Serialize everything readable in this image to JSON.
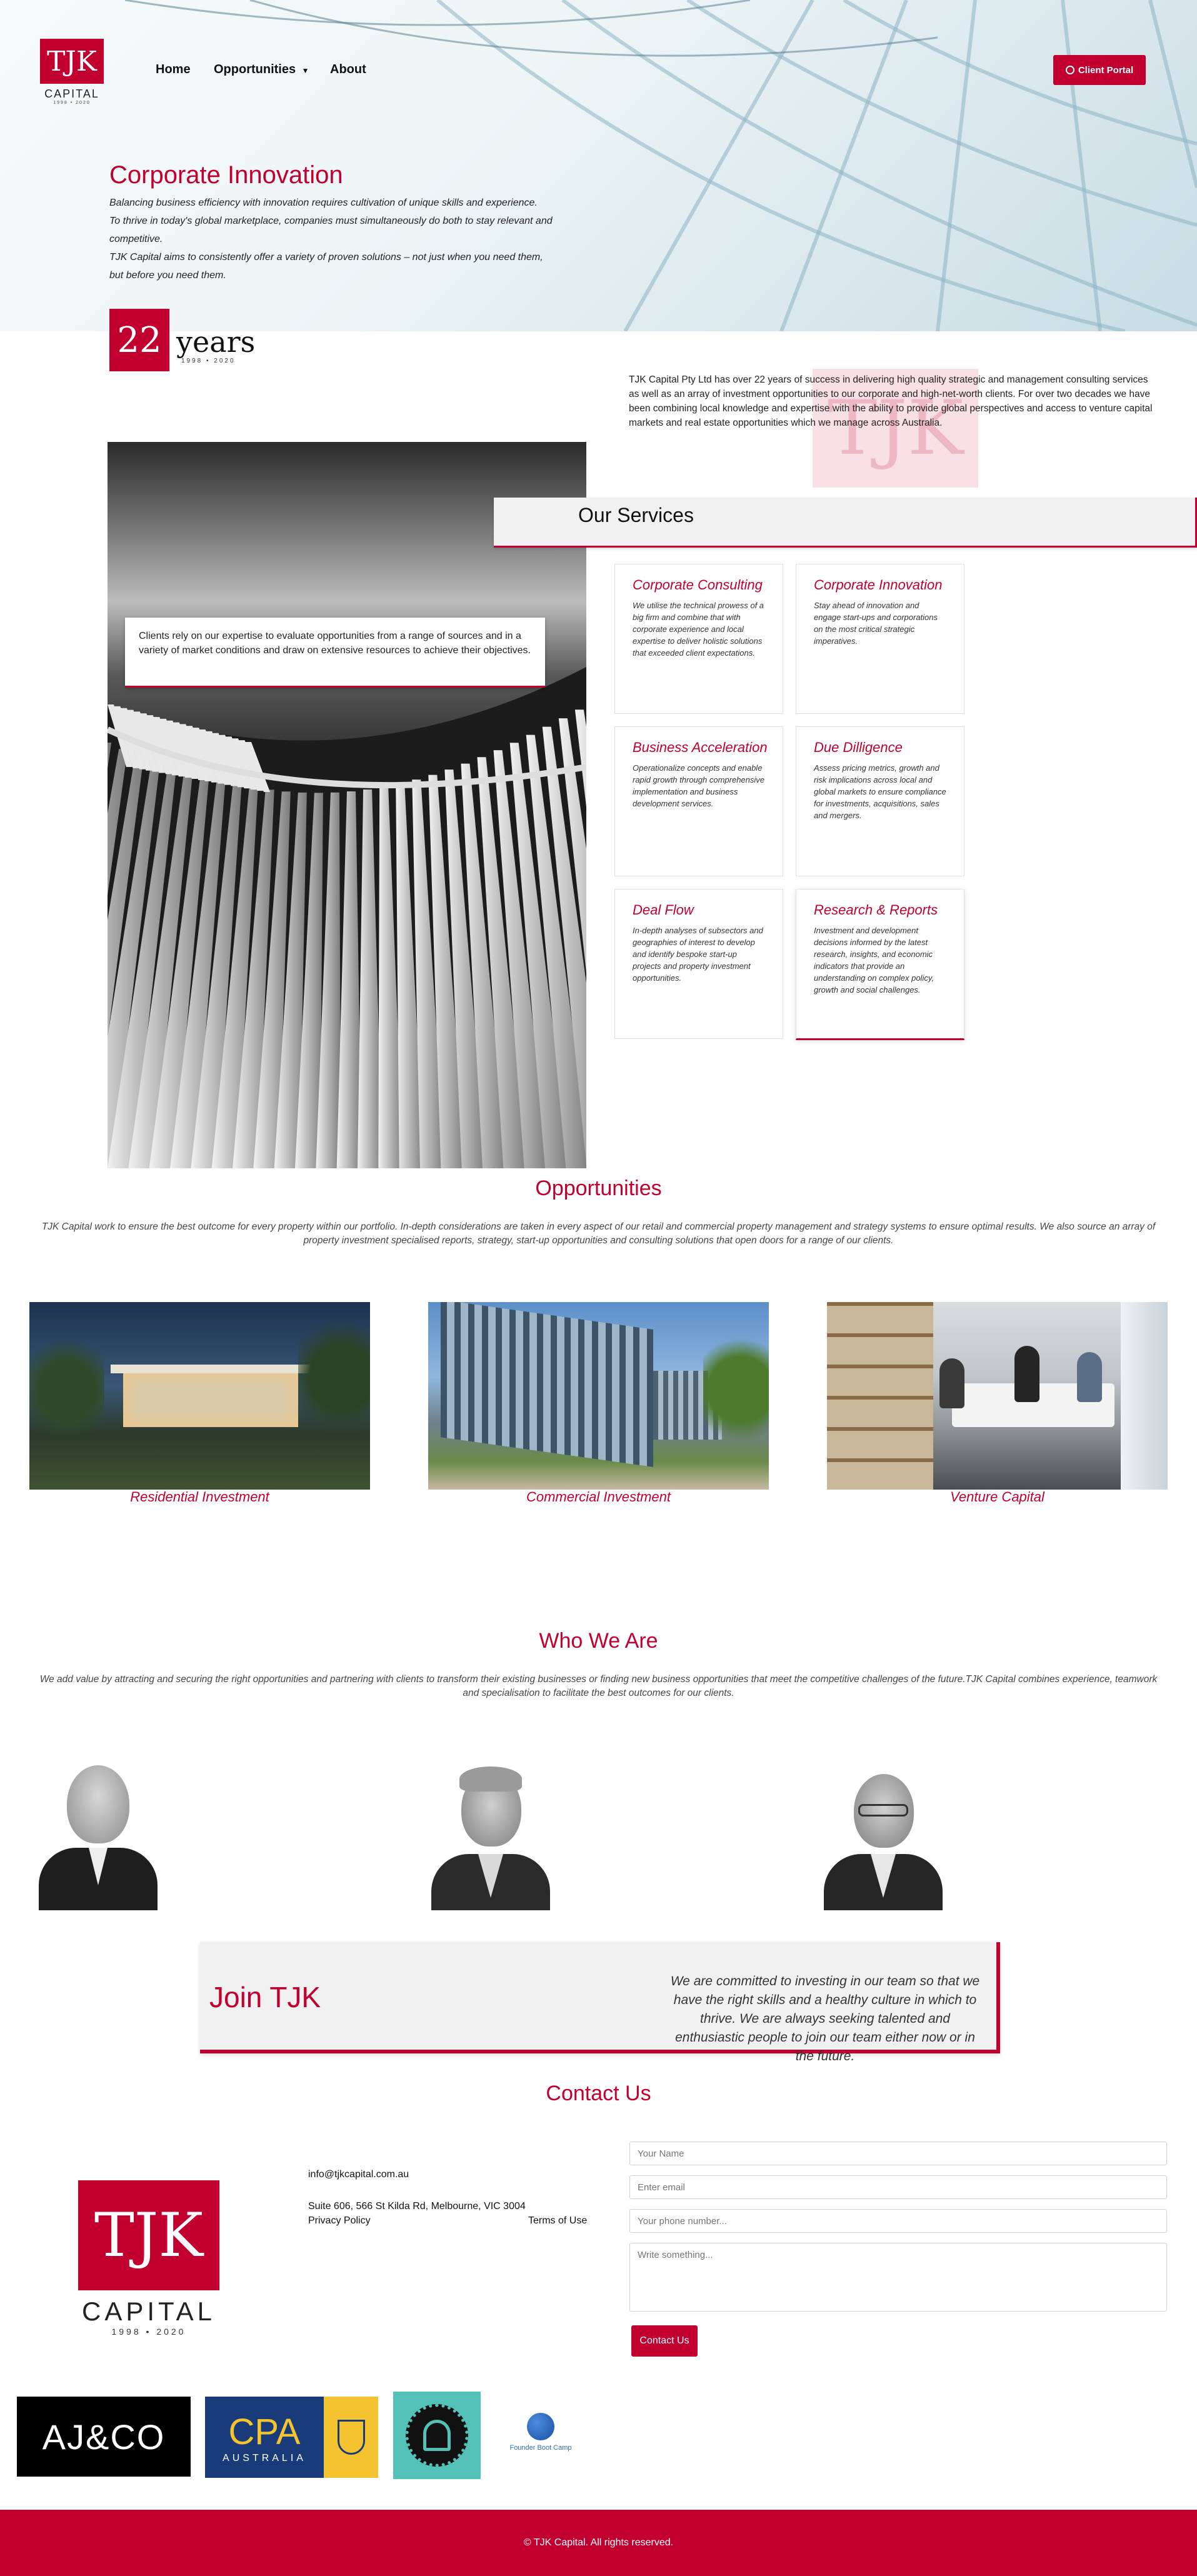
{
  "brand": {
    "logo_letters": "TJK",
    "logo_word": "CAPITAL",
    "logo_years": "1998 • 2020",
    "accent": "#c2002f"
  },
  "nav": {
    "home": "Home",
    "opportunities": "Opportunities",
    "about": "About",
    "client_portal": "Client Portal"
  },
  "hero": {
    "title": "Corporate Innovation",
    "lines": [
      "Balancing business efficiency with innovation requires cultivation of unique skills and experience.",
      "To thrive in today's global marketplace, companies must simultaneously do both to stay relevant and",
      "competitive.",
      "TJK Capital aims to consistently offer a variety of proven solutions – not just when you need them,",
      "but before you need them."
    ]
  },
  "years_badge": {
    "number": "22",
    "word": "years",
    "range": "1998 • 2020"
  },
  "about": "TJK Capital Pty Ltd has over 22 years of success in delivering high quality strategic and management consulting services as well as an array of investment opportunities to our corporate and high-net-worth clients. For over two decades we have been combining local knowledge and expertise with the ability to provide global perspectives and access to venture capital markets and real estate opportunities which we manage across Australia.",
  "callout": "Clients rely on our expertise to evaluate opportunities from a range of sources and in a variety of market conditions and draw on extensive resources to achieve their objectives.",
  "services": {
    "title": "Our Services",
    "items": [
      {
        "title": "Corporate Consulting",
        "text": "We utilise the technical prowess of a big firm and combine that with corporate experience and local expertise to deliver holistic solutions that exceeded client expectations."
      },
      {
        "title": "Corporate Innovation",
        "text": "Stay ahead of innovation and engage start-ups and corporations on the most critical strategic imperatives."
      },
      {
        "title": "Business Acceleration",
        "text": "Operationalize concepts and enable rapid growth through comprehensive implementation and business development services."
      },
      {
        "title": "Due Dilligence",
        "text": "Assess pricing metrics, growth and risk implications across local and global markets to ensure compliance for investments, acquisitions, sales and mergers."
      },
      {
        "title": "Deal Flow",
        "text": "In-depth analyses of subsectors and geographies of interest to develop and identify bespoke start-up projects and property investment opportunities."
      },
      {
        "title": "Research & Reports",
        "text": "Investment and development decisions informed by the latest research, insights, and economic indicators that provide an understanding on complex policy, growth and social challenges."
      }
    ]
  },
  "opportunities": {
    "title": "Opportunities",
    "desc": "TJK Capital work to ensure the best outcome for every property within our portfolio. In-depth considerations are taken in every aspect of our retail and commercial property management and strategy systems to ensure optimal results. We also source an array of property investment specialised reports, strategy, start-up opportunities and consulting solutions that open doors for a range of our clients.",
    "items": [
      {
        "label": "Residential Investment"
      },
      {
        "label": "Commercial Investment"
      },
      {
        "label": "Venture Capital"
      }
    ]
  },
  "who": {
    "title": "Who We Are",
    "desc": "We add value by attracting and securing the right opportunities and partnering with clients to transform their existing businesses or finding new business opportunities that meet the competitive challenges of the future.TJK Capital combines experience, teamwork and specialisation to facilitate the best outcomes for our clients."
  },
  "join": {
    "title": "Join TJK",
    "text": "We are committed to investing in our team so that we have the right skills and a healthy culture in which to thrive. We are always seeking talented and enthusiastic people to join our team either now or in the future."
  },
  "contact": {
    "title": "Contact Us",
    "email": "info@tjkcapital.com.au",
    "address": "Suite 606, 566 St Kilda Rd, Melbourne, VIC 3004",
    "privacy": "Privacy Policy",
    "terms": "Terms of Use",
    "form": {
      "name_ph": "Your Name",
      "email_ph": "Enter email",
      "phone_ph": "Your phone number...",
      "message_ph": "Write something...",
      "submit": "Contact Us"
    }
  },
  "partners": {
    "ajco": "AJ&CO",
    "cpa_top": "CPA",
    "cpa_bottom": "AUSTRALIA",
    "fbc": "Founder Boot Camp"
  },
  "footer": "© TJK Capital. All rights reserved."
}
